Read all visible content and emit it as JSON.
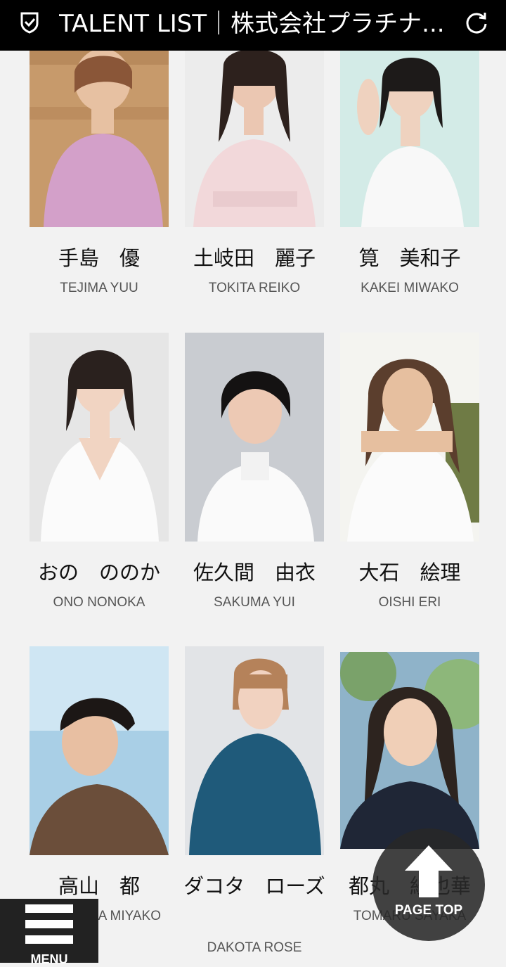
{
  "header": {
    "title": "TALENT LIST｜株式会社プラチナ...",
    "shield_icon": "shield-check-icon",
    "reload_icon": "reload-icon"
  },
  "talents": [
    {
      "jp": "手島　優",
      "en": "TEJIMA YUU"
    },
    {
      "jp": "土岐田　麗子",
      "en": "TOKITA REIKO"
    },
    {
      "jp": "筧　美和子",
      "en": "KAKEI MIWAKO"
    },
    {
      "jp": "おの　ののか",
      "en": "ONO NONOKA"
    },
    {
      "jp": "佐久間　由衣",
      "en": "SAKUMA YUI"
    },
    {
      "jp": "大石　絵理",
      "en": "OISHI ERI"
    },
    {
      "jp": "高山　都",
      "en": "TAKAYAMA MIYAKO"
    },
    {
      "jp": "ダコタ　ローズ",
      "en": "DAKOTA ROSE"
    },
    {
      "jp": "都丸　紗也華",
      "en": "TOMARU SAYAKA"
    }
  ],
  "menu": {
    "label": "MENU",
    "icon": "hamburger-icon"
  },
  "page_top": {
    "label": "PAGE TOP",
    "icon": "arrow-up-icon"
  }
}
